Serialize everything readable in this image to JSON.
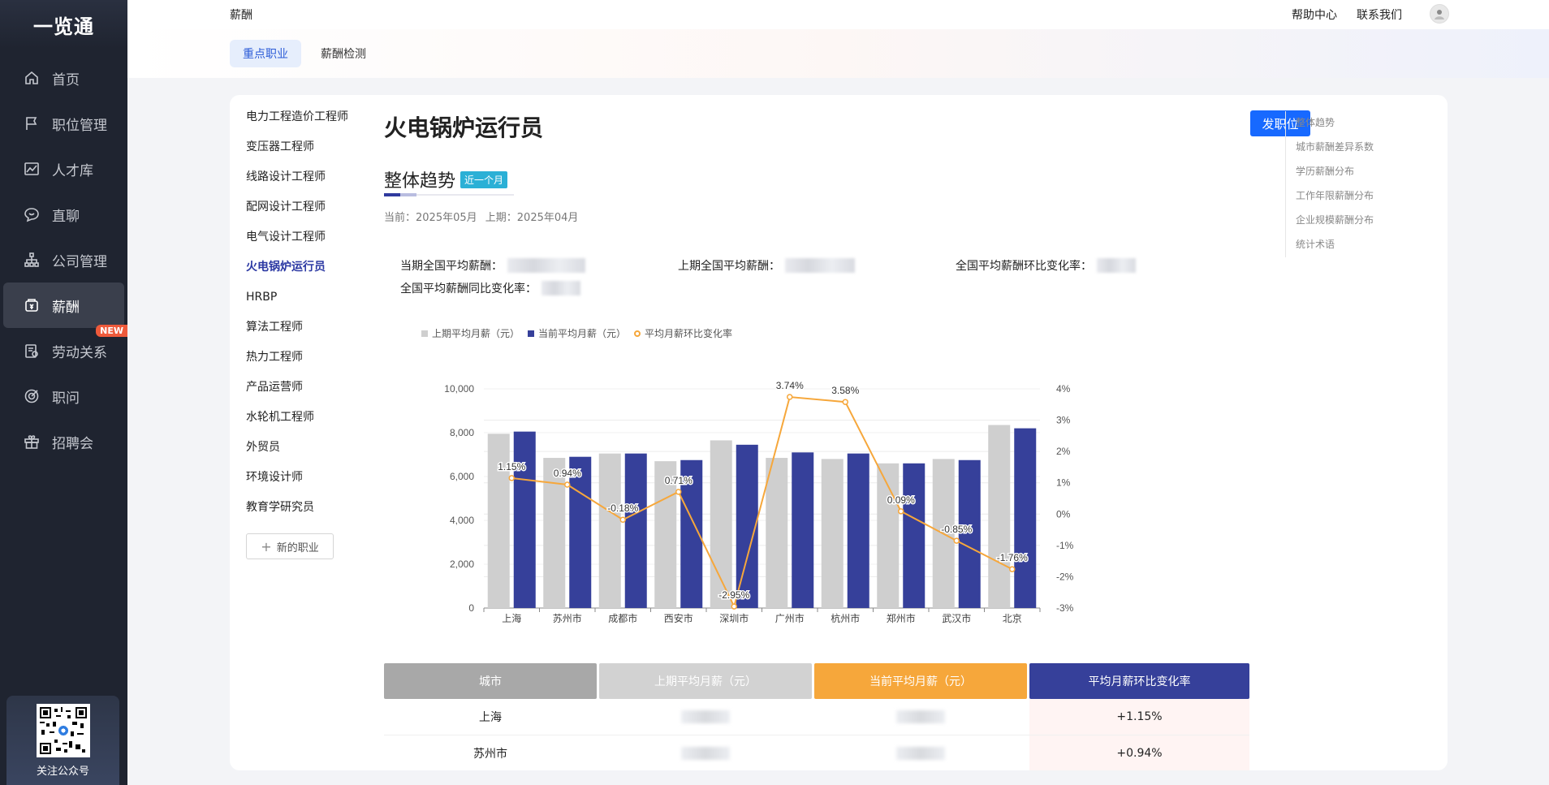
{
  "sidebar": {
    "logo": "一览通",
    "items": [
      {
        "label": "首页",
        "icon": "home-icon",
        "active": false
      },
      {
        "label": "职位管理",
        "icon": "flag-icon",
        "active": false
      },
      {
        "label": "人才库",
        "icon": "chart-icon",
        "active": false
      },
      {
        "label": "直聊",
        "icon": "chat-icon",
        "active": false
      },
      {
        "label": "公司管理",
        "icon": "org-icon",
        "active": false
      },
      {
        "label": "薪酬",
        "icon": "salary-icon",
        "active": true
      },
      {
        "label": "劳动关系",
        "icon": "contract-icon",
        "active": false,
        "badge": "NEW"
      },
      {
        "label": "职问",
        "icon": "target-icon",
        "active": false
      },
      {
        "label": "招聘会",
        "icon": "gift-icon",
        "active": false
      }
    ],
    "qr_label": "关注公众号"
  },
  "topbar": {
    "page_name": "薪酬",
    "help": "帮助中心",
    "contact": "联系我们"
  },
  "tabs": [
    {
      "label": "重点职业",
      "active": true
    },
    {
      "label": "薪酬检测",
      "active": false
    }
  ],
  "jobs": {
    "items": [
      "电力工程造价工程师",
      "变压器工程师",
      "线路设计工程师",
      "配网设计工程师",
      "电气设计工程师",
      "火电锅炉运行员",
      "HRBP",
      "算法工程师",
      "热力工程师",
      "产品运营师",
      "水轮机工程师",
      "外贸员",
      "环境设计师",
      "教育学研究员"
    ],
    "active_index": 5,
    "new_job": "新的职业"
  },
  "main": {
    "title": "火电锅炉运行员",
    "post_button": "发职位",
    "section_title": "整体趋势",
    "section_tag": "近一个月",
    "period_current": "当前：2025年05月",
    "period_previous": "上期：2025年04月",
    "stats": {
      "current_avg_label": "当期全国平均薪酬：",
      "previous_avg_label": "上期全国平均薪酬：",
      "mom_rate_label": "全国平均薪酬环比变化率：",
      "yoy_rate_label": "全国平均薪酬同比变化率："
    }
  },
  "chart_data": {
    "type": "bar",
    "categories": [
      "上海",
      "苏州市",
      "成都市",
      "西安市",
      "深圳市",
      "广州市",
      "杭州市",
      "郑州市",
      "武汉市",
      "北京"
    ],
    "series": [
      {
        "name": "上期平均月薪（元）",
        "type": "bar",
        "color": "#cfcfcf",
        "values": [
          7950,
          6850,
          7050,
          6700,
          7650,
          6850,
          6800,
          6600,
          6800,
          8350
        ]
      },
      {
        "name": "当前平均月薪（元）",
        "type": "bar",
        "color": "#36409a",
        "values": [
          8050,
          6900,
          7050,
          6750,
          7450,
          7100,
          7050,
          6600,
          6750,
          8200
        ]
      },
      {
        "name": "平均月薪环比变化率",
        "type": "line",
        "axis": "right",
        "color": "#f6a73b",
        "values": [
          1.15,
          0.94,
          -0.18,
          0.71,
          -2.95,
          3.74,
          3.58,
          0.09,
          -0.85,
          -1.76
        ],
        "labels": [
          "1.15%",
          "0.94%",
          "-0.18%",
          "0.71%",
          "-2.95%",
          "3.74%",
          "3.58%",
          "0.09%",
          "-0.85%",
          "-1.76%"
        ]
      }
    ],
    "y_left": {
      "min": 0,
      "max": 10000,
      "ticks": [
        "0",
        "2,000",
        "4,000",
        "6,000",
        "8,000",
        "10,000"
      ]
    },
    "y_right": {
      "min": -3,
      "max": 4,
      "ticks": [
        "-3%",
        "-2%",
        "-1%",
        "0%",
        "1%",
        "2%",
        "3%",
        "4%"
      ]
    },
    "legend": [
      "上期平均月薪（元）",
      "当前平均月薪（元）",
      "平均月薪环比变化率"
    ],
    "legend_position": "top-left",
    "grid": true
  },
  "table": {
    "headers": [
      {
        "label": "城市",
        "color": "#a8a8a8"
      },
      {
        "label": "上期平均月薪（元）",
        "color": "#d2d2d2"
      },
      {
        "label": "当前平均月薪（元）",
        "color": "#f6a73b"
      },
      {
        "label": "平均月薪环比变化率",
        "color": "#36409a"
      }
    ],
    "rows": [
      {
        "city": "上海",
        "rate": "+1.15%"
      },
      {
        "city": "苏州市",
        "rate": "+0.94%"
      }
    ]
  },
  "anchors": [
    "整体趋势",
    "城市薪酬差异系数",
    "学历薪酬分布",
    "工作年限薪酬分布",
    "企业规模薪酬分布",
    "统计术语"
  ]
}
